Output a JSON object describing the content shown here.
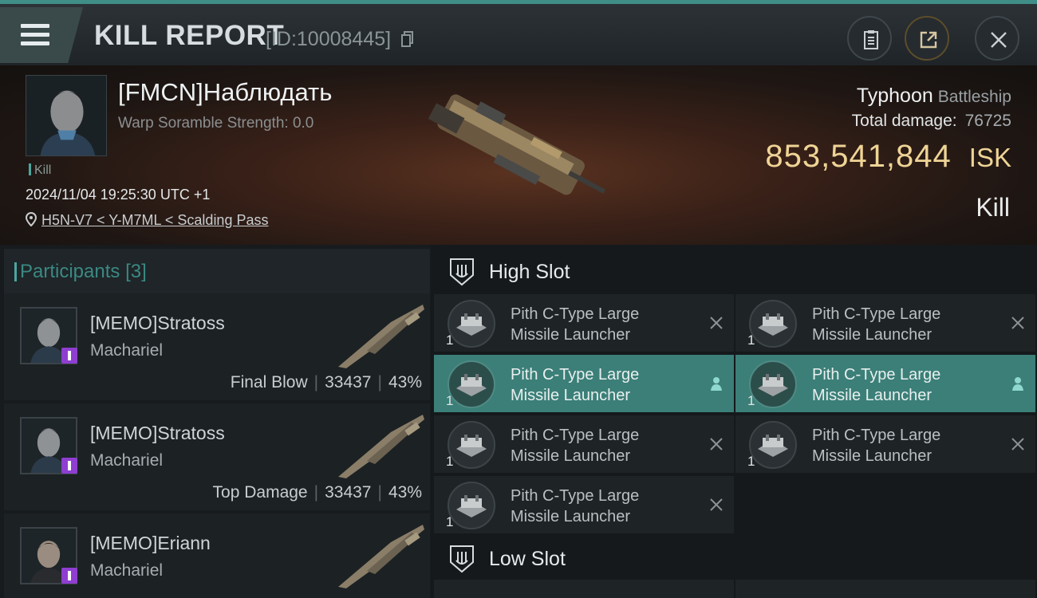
{
  "header": {
    "title": "KILL REPORT",
    "report_id": "[ID:10008445]",
    "icons": {
      "menu": "hamburger-menu-icon",
      "copy": "copy-icon",
      "report": "clipboard-icon",
      "share": "share-external-icon",
      "close": "close-icon"
    }
  },
  "victim": {
    "name": "[FMCN]Наблюдать",
    "subtitle": "Warp Soramble Strength: 0.0",
    "kill_tag": "Kill",
    "timestamp": "2024/11/04 19:25:30 UTC +1",
    "location": "H5N-V7 < Y-M7ML < Scalding Pass",
    "ship_name": "Typhoon",
    "ship_class": "Battleship",
    "damage_label": "Total damage:",
    "damage_value": "76725",
    "isk_amount": "853,541,844",
    "isk_currency": "ISK",
    "result": "Kill"
  },
  "participants": {
    "label": "Participants",
    "count": "[3]",
    "items": [
      {
        "name": "[MEMO]Stratoss",
        "ship": "Machariel",
        "stat_label": "Final Blow",
        "damage": "33437",
        "percent": "43%"
      },
      {
        "name": "[MEMO]Stratoss",
        "ship": "Machariel",
        "stat_label": "Top Damage",
        "damage": "33437",
        "percent": "43%"
      },
      {
        "name": "[MEMO]Eriann",
        "ship": "Machariel"
      }
    ]
  },
  "high_slot": {
    "title": "High Slot",
    "modules": [
      {
        "name_line1": "Pith C-Type Large",
        "name_line2": "Missile Launcher",
        "qty": "1",
        "status": "destroyed"
      },
      {
        "name_line1": "Pith C-Type Large",
        "name_line2": "Missile Launcher",
        "qty": "1",
        "status": "destroyed"
      },
      {
        "name_line1": "Pith C-Type Large",
        "name_line2": "Missile Launcher",
        "qty": "1",
        "status": "dropped"
      },
      {
        "name_line1": "Pith C-Type Large",
        "name_line2": "Missile Launcher",
        "qty": "1",
        "status": "dropped"
      },
      {
        "name_line1": "Pith C-Type Large",
        "name_line2": "Missile Launcher",
        "qty": "1",
        "status": "destroyed"
      },
      {
        "name_line1": "Pith C-Type Large",
        "name_line2": "Missile Launcher",
        "qty": "1",
        "status": "destroyed"
      },
      {
        "name_line1": "Pith C-Type Large",
        "name_line2": "Missile Launcher",
        "qty": "1",
        "status": "destroyed"
      }
    ]
  },
  "low_slot": {
    "title": "Low Slot"
  },
  "colors": {
    "accent": "#4aa79f",
    "isk": "#efd496",
    "selected_row": "#3b7f78",
    "badge": "#8e3ed0"
  }
}
